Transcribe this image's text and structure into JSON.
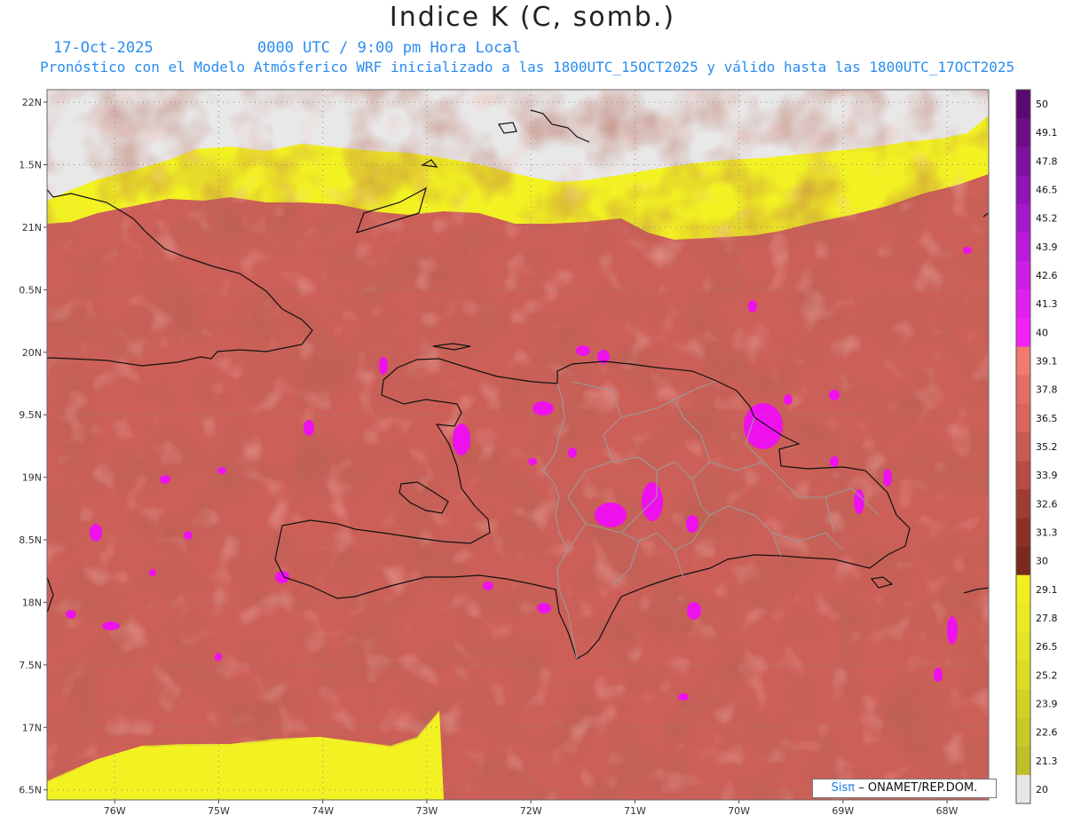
{
  "header": {
    "title": "Indice K (C, somb.)",
    "date": "17-Oct-2025",
    "time": "0000 UTC / 9:00 pm Hora Local",
    "description": "Pronóstico con el Modelo Atmósferico WRF inicializado a las 1800UTC_15OCT2025 y válido hasta las  1800UTC_17OCT2025"
  },
  "credit": {
    "logo": "Sisπ",
    "text": "– ONAMET/REP.DOM."
  },
  "map": {
    "lon_range": [
      -76.65,
      -67.6
    ],
    "lat_range": [
      16.42,
      22.1
    ],
    "lon_ticks": [
      -76,
      -75,
      -74,
      -73,
      -72,
      -71,
      -70,
      -69,
      -68
    ],
    "lat_ticks": [
      22,
      21.5,
      21,
      20.5,
      20,
      19.5,
      19,
      18.5,
      18,
      17.5,
      17,
      16.5
    ],
    "lon_tick_labels": [
      "76W",
      "75W",
      "74W",
      "73W",
      "72W",
      "71W",
      "70W",
      "69W",
      "68W"
    ],
    "lat_tick_labels": [
      "22N",
      "1.5N",
      "21N",
      "0.5N",
      "20N",
      "9.5N",
      "19N",
      "8.5N",
      "18N",
      "7.5N",
      "17N",
      "6.5N"
    ],
    "colors": {
      "no_data": "#e8e8e8",
      "background_field": "#cc6058",
      "low_yellow": "#f2f222",
      "high_magenta": "#ee11ee",
      "coast": "#111111",
      "province_lines": "#9a9a9a"
    }
  },
  "colorbar": {
    "levels": [
      "50",
      "49.1",
      "47.8",
      "46.5",
      "45.2",
      "43.9",
      "42.6",
      "41.3",
      "40",
      "39.1",
      "37.8",
      "36.5",
      "35.2",
      "33.9",
      "32.6",
      "31.3",
      "30",
      "29.1",
      "27.8",
      "26.5",
      "25.2",
      "23.9",
      "22.6",
      "21.3",
      "20"
    ],
    "colors": [
      "#5a0a6e",
      "#6c0d86",
      "#7e119e",
      "#9014b6",
      "#a418c8",
      "#b81cd8",
      "#cc1ee4",
      "#e020ee",
      "#f222f8",
      "#f07a70",
      "#e26f66",
      "#d8665d",
      "#c95a52",
      "#b84c44",
      "#a03d33",
      "#8c3225",
      "#7a2a1c",
      "#f0f020",
      "#eaea22",
      "#e4e424",
      "#dcdc25",
      "#d2d226",
      "#c8c828",
      "#bebe2a",
      "#e6e6e6"
    ]
  }
}
